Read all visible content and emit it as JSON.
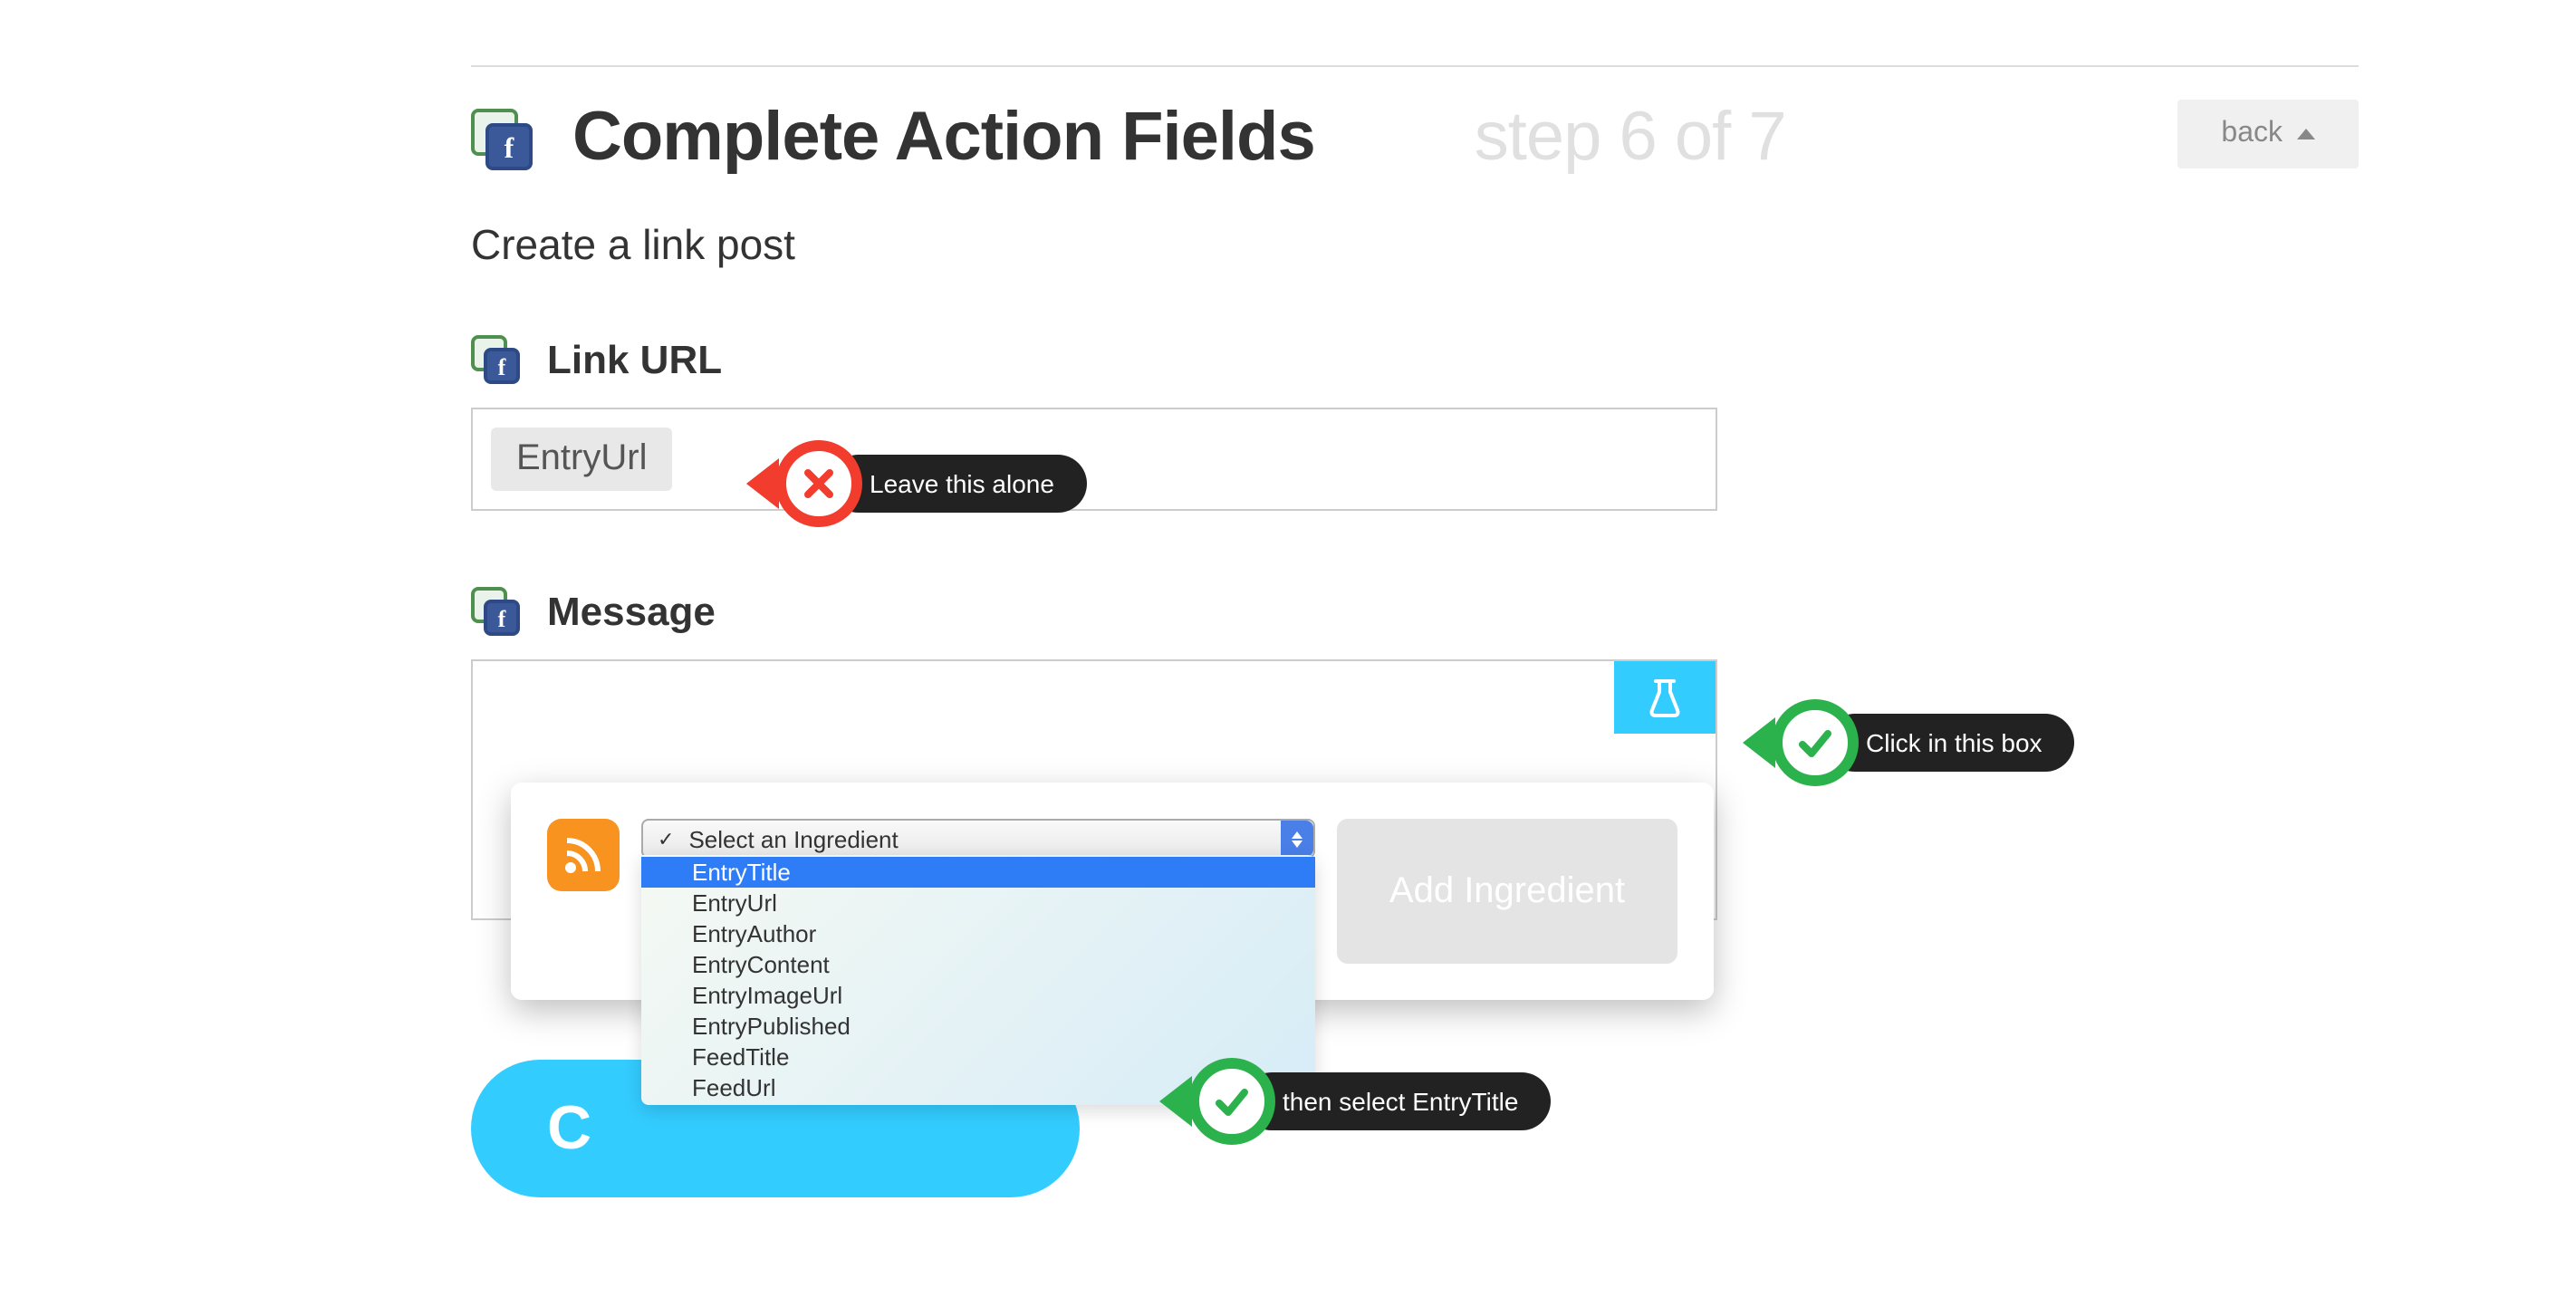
{
  "header": {
    "title": "Complete Action Fields",
    "step": "step 6 of 7",
    "back_label": "back"
  },
  "subtitle": "Create a link post",
  "link_url": {
    "label": "Link URL",
    "ingredient": "EntryUrl"
  },
  "message": {
    "label": "Message"
  },
  "ingredient_popup": {
    "placeholder": "Select an Ingredient",
    "options": [
      "EntryTitle",
      "EntryUrl",
      "EntryAuthor",
      "EntryContent",
      "EntryImageUrl",
      "EntryPublished",
      "FeedTitle",
      "FeedUrl"
    ],
    "highlighted_index": 0,
    "add_button": "Add Ingredient"
  },
  "annotations": {
    "leave_alone": "Leave this alone",
    "click_box": "Click in this box",
    "select_entrytitle": "then select EntryTitle"
  },
  "create_button_visible_text": "C"
}
